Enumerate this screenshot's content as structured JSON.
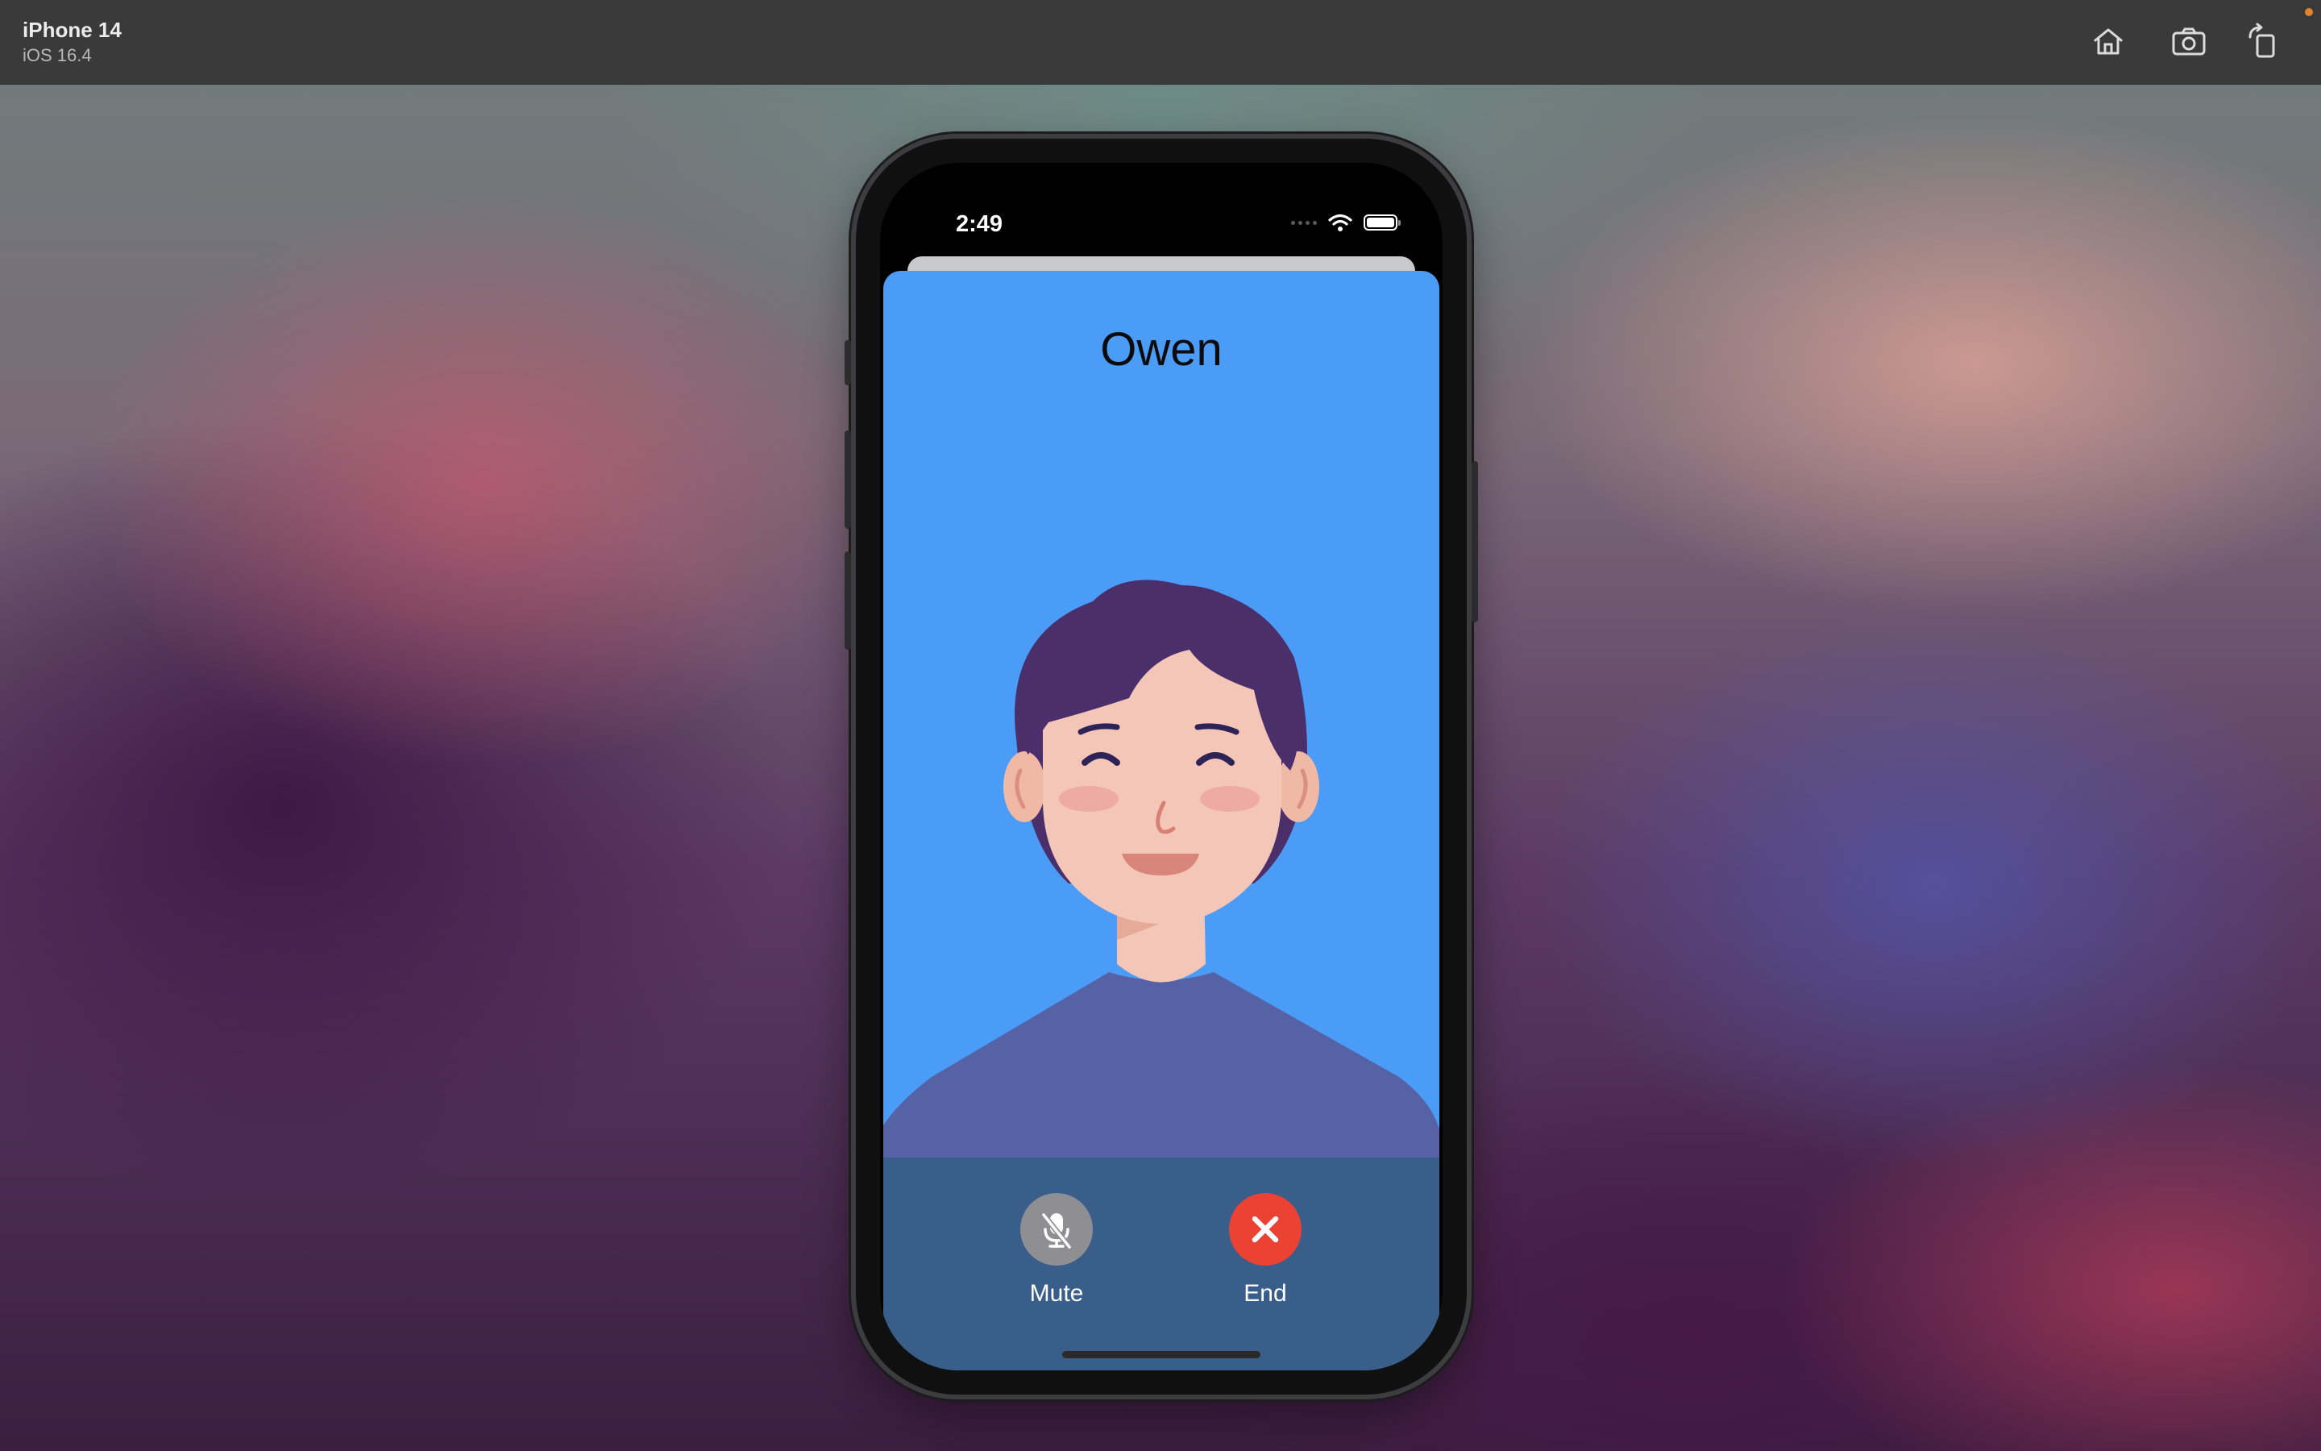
{
  "simulator": {
    "device_name": "iPhone 14",
    "os_version": "iOS 16.4",
    "toolbar": [
      {
        "name": "home-icon",
        "label": "Home"
      },
      {
        "name": "screenshot-icon",
        "label": "Screenshot"
      },
      {
        "name": "rotate-icon",
        "label": "Rotate"
      }
    ]
  },
  "status_bar": {
    "time": "2:49",
    "icons": [
      "signal-dots-icon",
      "wifi-icon",
      "battery-icon"
    ]
  },
  "call": {
    "caller_name": "Owen",
    "avatar_icon": "caller-avatar-illustration",
    "mute_label": "Mute",
    "end_label": "End"
  },
  "colors": {
    "sheet_background": "#4a9cf7",
    "control_panel": "#3a5e8a",
    "mute_button": "#8e8e93",
    "end_button": "#ec4234",
    "hair": "#4b2f6b",
    "skin": "#f3c6b8",
    "shirt": "#5563a6"
  }
}
